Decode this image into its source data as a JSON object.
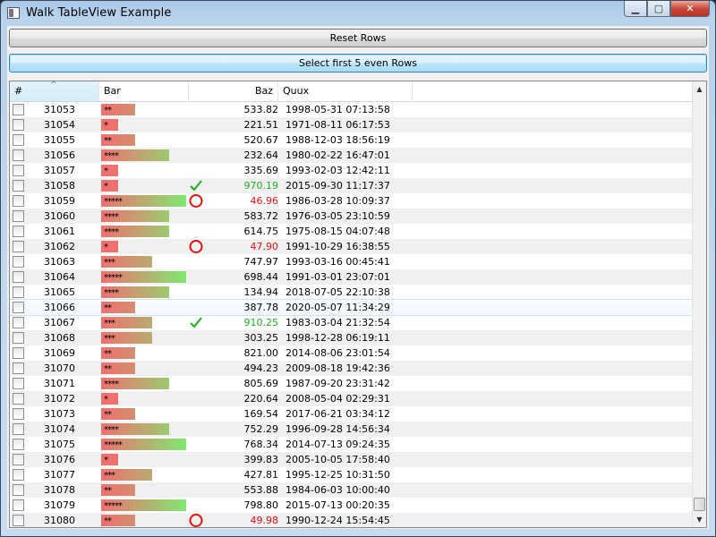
{
  "window": {
    "title": "Walk TableView Example"
  },
  "buttons": {
    "reset": "Reset Rows",
    "select_even": "Select first 5 even Rows"
  },
  "table": {
    "columns": [
      "#",
      "Bar",
      "Baz",
      "Quux"
    ],
    "sorted_column": "#",
    "rows": [
      {
        "num": "31053",
        "bar": "**",
        "stars": 2,
        "baz": "533.82",
        "quux": "1998-05-31 07:13:58",
        "mark": ""
      },
      {
        "num": "31054",
        "bar": "*",
        "stars": 1,
        "baz": "221.51",
        "quux": "1971-08-11 06:17:53",
        "mark": ""
      },
      {
        "num": "31055",
        "bar": "**",
        "stars": 2,
        "baz": "520.67",
        "quux": "1988-12-03 18:56:19",
        "mark": ""
      },
      {
        "num": "31056",
        "bar": "****",
        "stars": 4,
        "baz": "232.64",
        "quux": "1980-02-22 16:47:01",
        "mark": ""
      },
      {
        "num": "31057",
        "bar": "*",
        "stars": 1,
        "baz": "335.69",
        "quux": "1993-02-03 12:42:11",
        "mark": ""
      },
      {
        "num": "31058",
        "bar": "*",
        "stars": 1,
        "baz": "970.19",
        "quux": "2015-09-30 11:17:37",
        "mark": "check"
      },
      {
        "num": "31059",
        "bar": "*****",
        "stars": 5,
        "baz": "46.96",
        "quux": "1986-03-28 10:09:37",
        "mark": "circle"
      },
      {
        "num": "31060",
        "bar": "****",
        "stars": 4,
        "baz": "583.72",
        "quux": "1976-03-05 23:10:59",
        "mark": ""
      },
      {
        "num": "31061",
        "bar": "****",
        "stars": 4,
        "baz": "614.75",
        "quux": "1975-08-15 04:07:48",
        "mark": ""
      },
      {
        "num": "31062",
        "bar": "*",
        "stars": 1,
        "baz": "47.90",
        "quux": "1991-10-29 16:38:55",
        "mark": "circle"
      },
      {
        "num": "31063",
        "bar": "***",
        "stars": 3,
        "baz": "747.97",
        "quux": "1993-03-16 00:45:41",
        "mark": ""
      },
      {
        "num": "31064",
        "bar": "*****",
        "stars": 5,
        "baz": "698.44",
        "quux": "1991-03-01 23:07:01",
        "mark": ""
      },
      {
        "num": "31065",
        "bar": "****",
        "stars": 4,
        "baz": "134.94",
        "quux": "2018-07-05 22:10:38",
        "mark": ""
      },
      {
        "num": "31066",
        "bar": "**",
        "stars": 2,
        "baz": "387.78",
        "quux": "2020-05-07 11:34:29",
        "mark": "",
        "selected": true
      },
      {
        "num": "31067",
        "bar": "***",
        "stars": 3,
        "baz": "910.25",
        "quux": "1983-03-04 21:32:54",
        "mark": "check"
      },
      {
        "num": "31068",
        "bar": "***",
        "stars": 3,
        "baz": "303.25",
        "quux": "1998-12-28 06:19:11",
        "mark": ""
      },
      {
        "num": "31069",
        "bar": "**",
        "stars": 2,
        "baz": "821.00",
        "quux": "2014-08-06 23:01:54",
        "mark": ""
      },
      {
        "num": "31070",
        "bar": "**",
        "stars": 2,
        "baz": "494.23",
        "quux": "2009-08-18 19:42:36",
        "mark": ""
      },
      {
        "num": "31071",
        "bar": "****",
        "stars": 4,
        "baz": "805.69",
        "quux": "1987-09-20 23:31:42",
        "mark": ""
      },
      {
        "num": "31072",
        "bar": "*",
        "stars": 1,
        "baz": "220.64",
        "quux": "2008-05-04 02:29:31",
        "mark": ""
      },
      {
        "num": "31073",
        "bar": "**",
        "stars": 2,
        "baz": "169.54",
        "quux": "2017-06-21 03:34:12",
        "mark": ""
      },
      {
        "num": "31074",
        "bar": "****",
        "stars": 4,
        "baz": "752.29",
        "quux": "1996-09-28 14:56:34",
        "mark": ""
      },
      {
        "num": "31075",
        "bar": "*****",
        "stars": 5,
        "baz": "768.34",
        "quux": "2014-07-13 09:24:35",
        "mark": ""
      },
      {
        "num": "31076",
        "bar": "*",
        "stars": 1,
        "baz": "399.83",
        "quux": "2005-10-05 17:58:40",
        "mark": ""
      },
      {
        "num": "31077",
        "bar": "***",
        "stars": 3,
        "baz": "427.81",
        "quux": "1995-12-25 10:31:50",
        "mark": ""
      },
      {
        "num": "31078",
        "bar": "**",
        "stars": 2,
        "baz": "553.88",
        "quux": "1984-06-03 10:00:40",
        "mark": ""
      },
      {
        "num": "31079",
        "bar": "*****",
        "stars": 5,
        "baz": "798.80",
        "quux": "2015-07-13 00:20:35",
        "mark": ""
      },
      {
        "num": "31080",
        "bar": "**",
        "stars": 2,
        "baz": "49.98",
        "quux": "1990-12-24 15:54:45",
        "mark": "circle"
      }
    ]
  },
  "colors": {
    "high_value": "#1fae1f",
    "low_value": "#e01010",
    "bar_low": "#f07070",
    "bar_high": "#80e870"
  }
}
